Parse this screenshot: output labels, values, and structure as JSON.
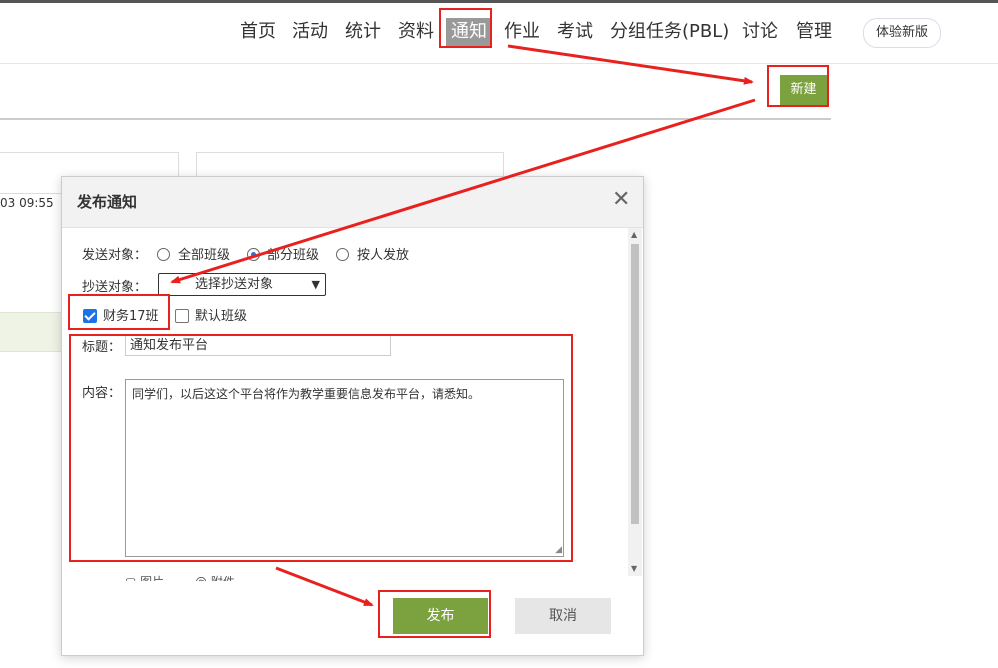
{
  "nav": {
    "items": [
      "首页",
      "活动",
      "统计",
      "资料",
      "通知",
      "作业",
      "考试",
      "分组任务(PBL)",
      "讨论",
      "管理"
    ],
    "active": "通知",
    "experience_label": "体验新版"
  },
  "toolbar": {
    "new_label": "新建"
  },
  "background": {
    "card_time": "03 09:55"
  },
  "modal": {
    "title": "发布通知",
    "send_target": {
      "label": "发送对象：",
      "options": [
        "全部班级",
        "部分班级",
        "按人发放"
      ],
      "selected": "部分班级"
    },
    "cc_target": {
      "label": "抄送对象：",
      "placeholder": "选择抄送对象"
    },
    "classes": [
      {
        "name": "财务17班",
        "checked": true
      },
      {
        "name": "默认班级",
        "checked": false
      }
    ],
    "subject": {
      "label": "标题：",
      "value": "通知发布平台"
    },
    "content": {
      "label": "内容：",
      "value": "同学们，以后这这个平台将作为教学重要信息发布平台，请悉知。"
    },
    "partial_labels": [
      "图片",
      "附件"
    ],
    "publish_label": "发布",
    "cancel_label": "取消"
  },
  "colors": {
    "accent": "#7ba23f",
    "annotation": "#e8211f",
    "nav_active_bg": "#999999"
  },
  "icons": [
    "close-icon",
    "dropdown-caret-icon",
    "scroll-up-icon",
    "scroll-down-icon",
    "resize-grip-icon"
  ]
}
